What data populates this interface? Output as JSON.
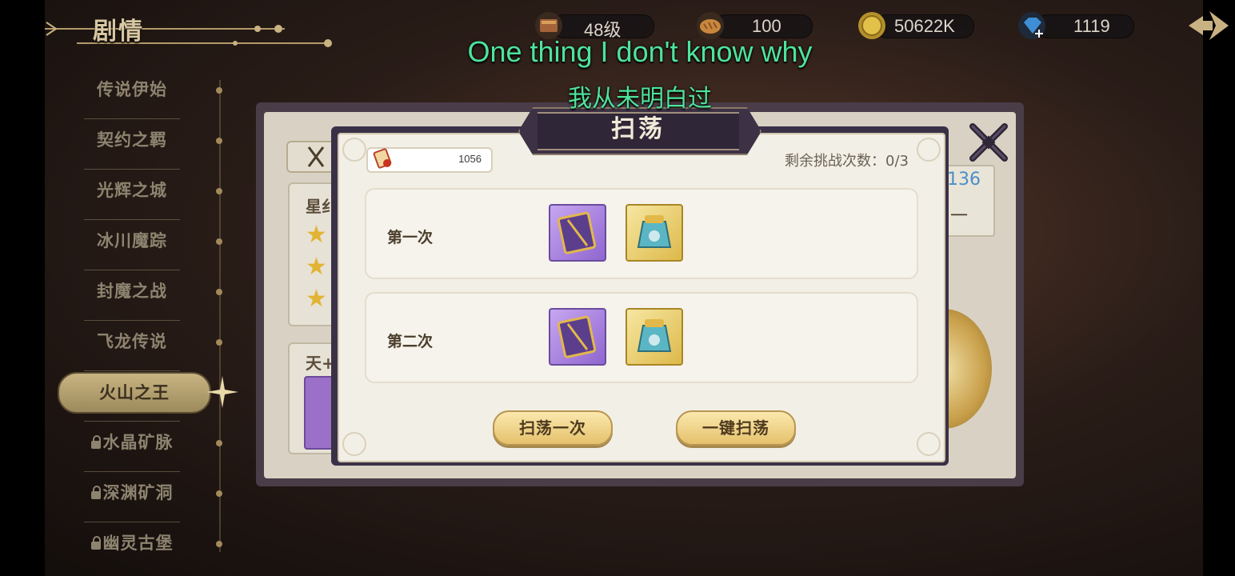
{
  "header": {
    "title": "剧情",
    "resources": [
      {
        "icon": "level-icon",
        "value": "48级"
      },
      {
        "icon": "bread-icon",
        "value": "100"
      },
      {
        "icon": "coin-icon",
        "value": "50622K"
      },
      {
        "icon": "diamond-icon",
        "value": "1119"
      }
    ]
  },
  "sidebar": {
    "chapters": [
      {
        "label": "传说伊始",
        "locked": false
      },
      {
        "label": "契约之羁",
        "locked": false
      },
      {
        "label": "光辉之城",
        "locked": false
      },
      {
        "label": "冰川魔踪",
        "locked": false
      },
      {
        "label": "封魔之战",
        "locked": false
      },
      {
        "label": "飞龙传说",
        "locked": false
      },
      {
        "label": "火山之王",
        "locked": false,
        "active": true
      },
      {
        "label": "水晶矿脉",
        "locked": true
      },
      {
        "label": "深渊矿洞",
        "locked": true
      },
      {
        "label": "幽灵古堡",
        "locked": true
      }
    ]
  },
  "background": {
    "left_label_1": "星纟",
    "left_label_2": "天+",
    "right_number": "136",
    "right_text": "一"
  },
  "modal": {
    "title": "扫荡",
    "ticket_count": "1056",
    "remaining_label": "剩余挑战次数：0/3",
    "rows": [
      {
        "label": "第一次",
        "rewards": [
          "spellbook-icon",
          "treasure-bag-icon"
        ]
      },
      {
        "label": "第二次",
        "rewards": [
          "spellbook-icon",
          "treasure-bag-icon"
        ]
      }
    ],
    "buttons": {
      "sweep_once": "扫荡一次",
      "sweep_all": "一键扫荡"
    }
  },
  "subtitles": {
    "en": "One thing I don't know why",
    "zh": "我从未明白过"
  },
  "colors": {
    "subtitle": "#4ee39b",
    "button_gold": "#e5c16c",
    "modal_frame": "#3b3146"
  }
}
